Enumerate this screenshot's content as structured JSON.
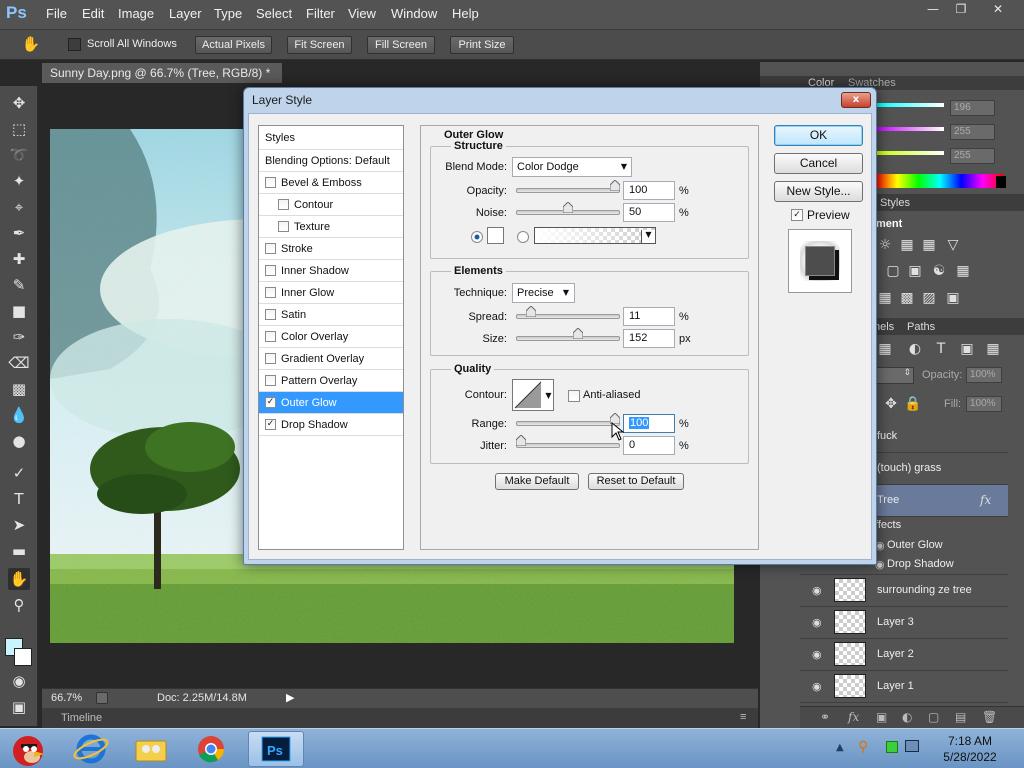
{
  "app": {
    "logo": "Ps"
  },
  "menubar": {
    "items": [
      "File",
      "Edit",
      "Image",
      "Layer",
      "Type",
      "Select",
      "Filter",
      "View",
      "Window",
      "Help"
    ],
    "window_buttons": {
      "minimize": "—",
      "restore": "❐",
      "close": "✕"
    }
  },
  "options_bar": {
    "tool_icon": "hand-icon",
    "scroll_all_label": "Scroll All Windows",
    "buttons": [
      "Actual Pixels",
      "Fit Screen",
      "Fill Screen",
      "Print Size"
    ]
  },
  "document": {
    "tab_title": "Sunny Day.png @ 66.7% (Tree, RGB/8) *",
    "tab_close": "×",
    "zoom": "66.7%",
    "doc_size": "Doc: 2.25M/14.8M",
    "timeline_label": "Timeline"
  },
  "tools": [
    "move-icon",
    "marquee-icon",
    "lasso-icon",
    "quick-select-icon",
    "crop-icon",
    "eyedropper-icon",
    "healing-icon",
    "brush-icon",
    "stamp-icon",
    "history-brush-icon",
    "eraser-icon",
    "gradient-icon",
    "blur-icon",
    "dodge-icon",
    "pen-icon",
    "type-icon",
    "path-select-icon",
    "shape-icon",
    "hand-icon",
    "zoom-icon"
  ],
  "right_panel": {
    "color_tabs": [
      "Color",
      "Swatches"
    ],
    "color_values": [
      "196",
      "255",
      "255"
    ],
    "adjust_tabs": [
      "Styles"
    ],
    "adjust_title": "ment",
    "layers_tabs": [
      "nels",
      "Paths"
    ],
    "opacity_label": "Opacity:",
    "opacity_value": "100%",
    "fill_label": "Fill:",
    "fill_value": "100%",
    "layers": [
      {
        "name": "fuck",
        "thumb": false
      },
      {
        "name": "(touch) grass",
        "thumb": false
      },
      {
        "name": "Tree",
        "thumb": false,
        "selected": true,
        "fx": "fx"
      },
      {
        "name": "ffects",
        "thumb": false,
        "sub": true
      },
      {
        "name": "Outer Glow",
        "thumb": false,
        "sub": true
      },
      {
        "name": "Drop Shadow",
        "thumb": false,
        "sub": true
      },
      {
        "name": "surrounding ze tree",
        "thumb": true
      },
      {
        "name": "Layer 3",
        "thumb": true
      },
      {
        "name": "Layer 2",
        "thumb": true
      },
      {
        "name": "Layer 1",
        "thumb": true
      }
    ]
  },
  "dialog": {
    "title": "Layer Style",
    "close": "x",
    "styles_list": [
      {
        "label": "Styles",
        "check": null
      },
      {
        "label": "Blending Options: Default",
        "check": null
      },
      {
        "label": "Bevel & Emboss",
        "check": false
      },
      {
        "label": "Contour",
        "check": false,
        "indent": true
      },
      {
        "label": "Texture",
        "check": false,
        "indent": true
      },
      {
        "label": "Stroke",
        "check": false
      },
      {
        "label": "Inner Shadow",
        "check": false
      },
      {
        "label": "Inner Glow",
        "check": false
      },
      {
        "label": "Satin",
        "check": false
      },
      {
        "label": "Color Overlay",
        "check": false
      },
      {
        "label": "Gradient Overlay",
        "check": false
      },
      {
        "label": "Pattern Overlay",
        "check": false
      },
      {
        "label": "Outer Glow",
        "check": true,
        "selected": true
      },
      {
        "label": "Drop Shadow",
        "check": true
      }
    ],
    "section_title": "Outer Glow",
    "structure": {
      "title": "Structure",
      "blend_mode_label": "Blend Mode:",
      "blend_mode_value": "Color Dodge",
      "opacity_label": "Opacity:",
      "opacity_value": "100",
      "opacity_level": 1.0,
      "noise_label": "Noise:",
      "noise_value": "50",
      "noise_level": 0.5,
      "percent": "%"
    },
    "elements": {
      "title": "Elements",
      "technique_label": "Technique:",
      "technique_value": "Precise",
      "spread_label": "Spread:",
      "spread_value": "11",
      "spread_level": 0.11,
      "size_label": "Size:",
      "size_value": "152",
      "size_level": 0.61,
      "percent": "%",
      "px": "px"
    },
    "quality": {
      "title": "Quality",
      "contour_label": "Contour:",
      "anti_aliased_label": "Anti-aliased",
      "range_label": "Range:",
      "range_value": "100",
      "range_level": 1.0,
      "jitter_label": "Jitter:",
      "jitter_value": "0",
      "jitter_level": 0.0,
      "percent": "%"
    },
    "make_default": "Make Default",
    "reset_default": "Reset to Default",
    "ok": "OK",
    "cancel": "Cancel",
    "new_style": "New Style...",
    "preview_label": "Preview"
  },
  "taskbar": {
    "time": "7:18 AM",
    "date": "5/28/2022"
  },
  "colors": {
    "accent": "#3399ff",
    "ps_blue": "#8ec5ff"
  }
}
